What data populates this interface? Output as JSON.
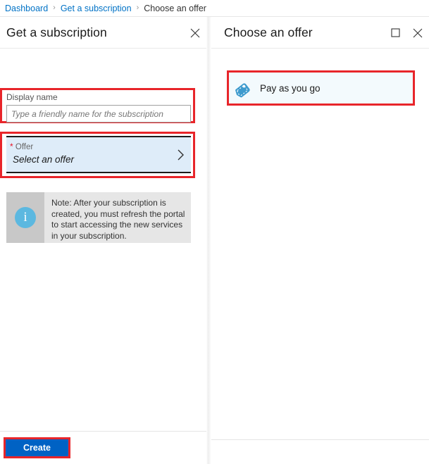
{
  "breadcrumb": {
    "items": [
      {
        "label": "Dashboard",
        "current": false
      },
      {
        "label": "Get a subscription",
        "current": false
      },
      {
        "label": "Choose an offer",
        "current": true
      }
    ],
    "separator": "›"
  },
  "left_blade": {
    "title": "Get a subscription",
    "close_label": "close-icon",
    "display_name": {
      "label": "Display name",
      "value": "",
      "placeholder": "Type a friendly name for the subscription"
    },
    "offer": {
      "required_marker": "*",
      "label": "Offer",
      "value": "Select an offer",
      "chevron": "chevron-right-icon"
    },
    "note": {
      "icon": "info-icon",
      "text": "Note: After your subscription is created, you must refresh the portal to start accessing the new services in your subscription."
    },
    "footer": {
      "create_label": "Create"
    }
  },
  "right_blade": {
    "title": "Choose an offer",
    "maximize_label": "maximize-icon",
    "close_label": "close-icon",
    "offers": [
      {
        "label": "Pay as you go",
        "icon": "tag-icon"
      }
    ]
  },
  "colors": {
    "highlight_red": "#e8252a",
    "link_blue": "#0072c6",
    "primary_button": "#0062c4",
    "selected_field": "#deecf9",
    "tile_background": "#f3fafd",
    "info_circle": "#5cb8e0",
    "note_background": "#e6e6e6",
    "note_icon_band": "#c8c8c8",
    "tag_icon": "#3e9bce"
  }
}
